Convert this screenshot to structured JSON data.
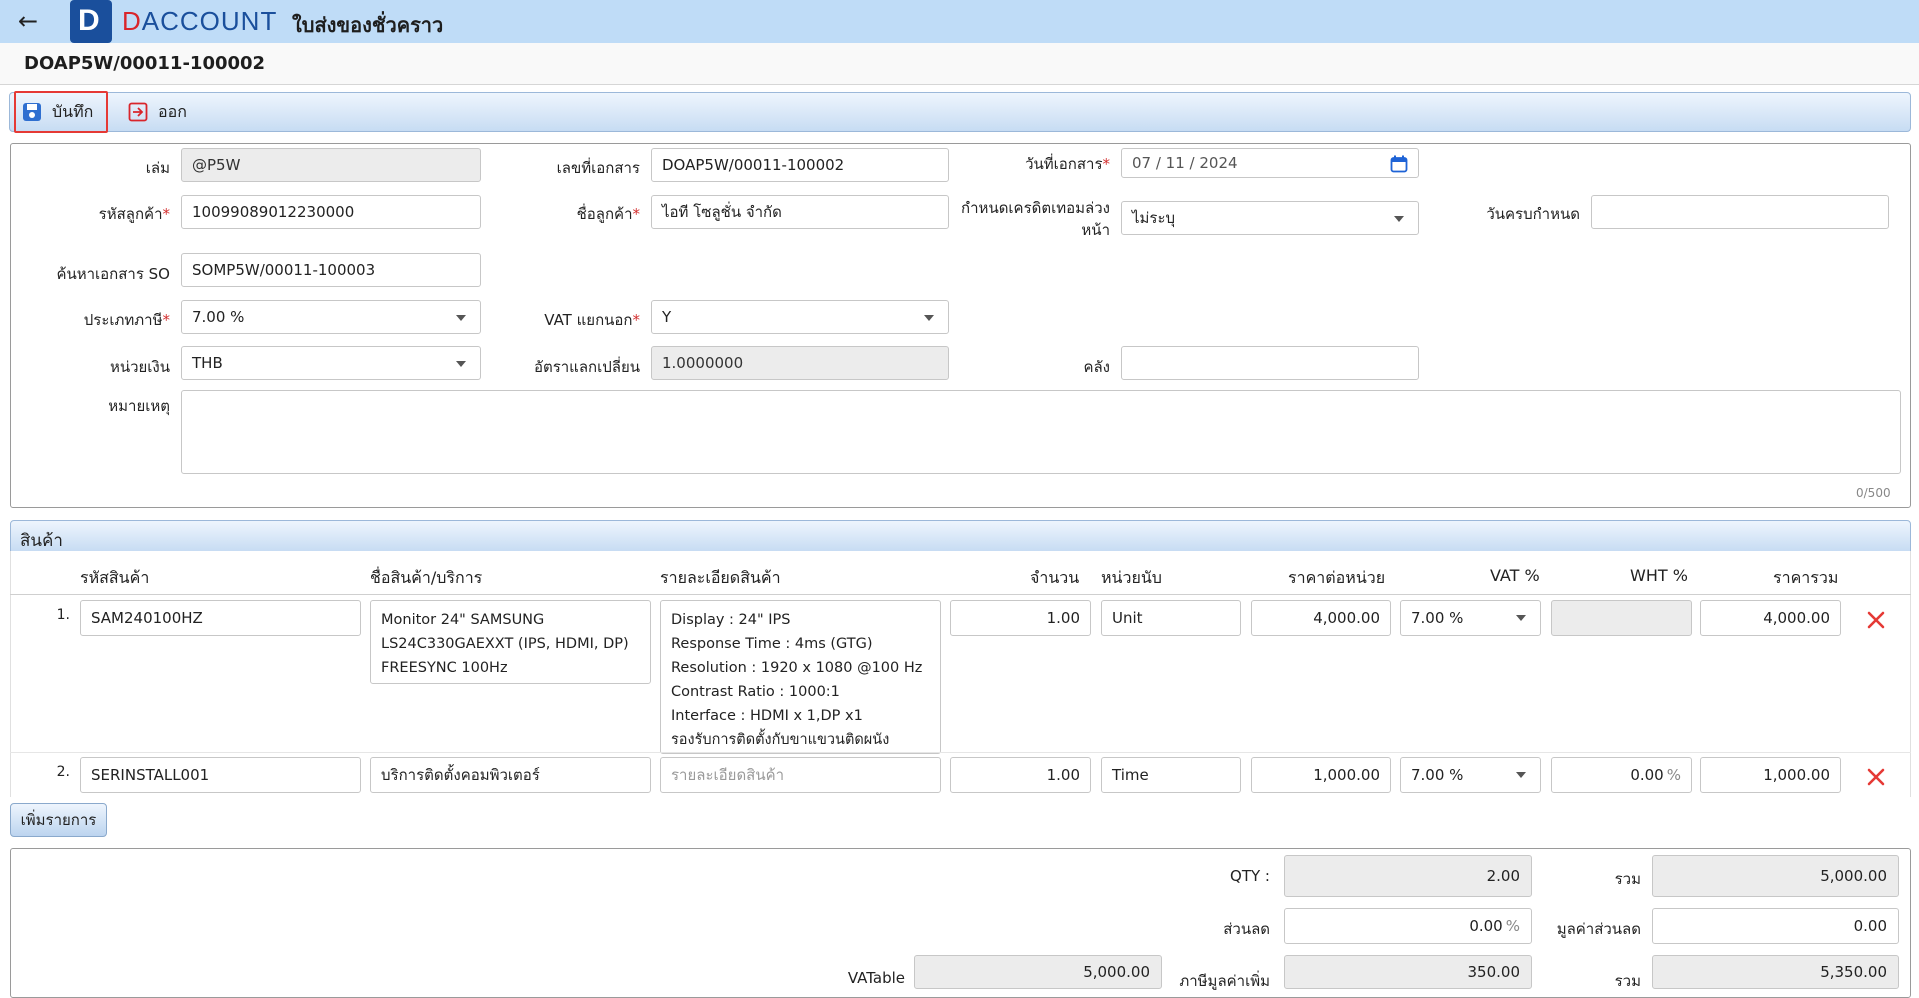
{
  "app": {
    "brand": "ACCOUNT",
    "title": "ใบส่งของชั่วคราว",
    "doc_heading": "DOAP5W/00011-100002"
  },
  "toolbar": {
    "save_label": "บันทึก",
    "exit_label": "ออก"
  },
  "form": {
    "book_label": "เล่ม",
    "book_value": "@P5W",
    "doc_no_label": "เลขที่เอกสาร",
    "doc_no_value": "DOAP5W/00011-100002",
    "doc_date_label": "วันที่เอกสาร",
    "doc_date_value": "07 / 11 /  2024",
    "customer_code_label": "รหัสลูกค้า",
    "customer_code_value": "10099089012230000",
    "customer_name_label": "ชื่อลูกค้า",
    "customer_name_value": "ไอที โซลูชั่น จำกัด",
    "credit_term_label_1": "กำหนดเครดิตเทอมล่วง",
    "credit_term_label_2": "หน้า",
    "credit_term_value": "ไม่ระบุ",
    "due_date_label": "วันครบกำหนด",
    "due_date_value": "",
    "so_search_label": "ค้นหาเอกสาร SO",
    "so_search_value": "SOMP5W/00011-100003",
    "tax_type_label": "ประเภทภาษี",
    "tax_type_value": "7.00 %",
    "vat_separate_label": "VAT แยกนอก",
    "vat_separate_value": "Y",
    "currency_label": "หน่วยเงิน",
    "currency_value": "THB",
    "exchange_rate_label": "อัตราแลกเปลี่ยน",
    "exchange_rate_value": "1.0000000",
    "warehouse_label": "คลัง",
    "warehouse_value": "",
    "remark_label": "หมายเหตุ",
    "remark_value": "",
    "remark_counter": "0/500"
  },
  "products": {
    "section_title": "สินค้า",
    "columns": {
      "code": "รหัสสินค้า",
      "name": "ชื่อสินค้า/บริการ",
      "detail": "รายละเอียดสินค้า",
      "qty": "จำนวน",
      "unit": "หน่วยนับ",
      "unit_price": "ราคาต่อหน่วย",
      "vat": "VAT %",
      "wht": "WHT %",
      "total": "ราคารวม"
    },
    "detail_placeholder": "รายละเอียดสินค้า",
    "rows": [
      {
        "no": "1.",
        "code": "SAM240100HZ",
        "name_lines": [
          "Monitor 24\" SAMSUNG",
          "LS24C330GAEXXT (IPS, HDMI, DP)",
          "FREESYNC 100Hz"
        ],
        "detail_lines": [
          "Display : 24\" IPS",
          "Response Time : 4ms (GTG)",
          "Resolution : 1920 x 1080 @100 Hz",
          "Contrast Ratio : 1000:1",
          "Interface : HDMI x 1,DP x1",
          "รองรับการติดตั้งกับขาแขวนติดผนัง"
        ],
        "qty": "1.00",
        "unit": "Unit",
        "unit_price": "4,000.00",
        "vat": "7.00 %",
        "wht": "",
        "total": "4,000.00"
      },
      {
        "no": "2.",
        "code": "SERINSTALL001",
        "name_lines": [
          "บริการติดตั้งคอมพิวเตอร์"
        ],
        "detail_lines": [],
        "qty": "1.00",
        "unit": "Time",
        "unit_price": "1,000.00",
        "vat": "7.00 %",
        "wht": "0.00",
        "wht_suffix": "%",
        "total": "1,000.00"
      }
    ],
    "add_row_label": "เพิ่มรายการ"
  },
  "summary": {
    "qty_label": "QTY :",
    "qty_value": "2.00",
    "sum_label": "รวม",
    "sum_value": "5,000.00",
    "discount_label": "ส่วนลด",
    "discount_value": "0.00",
    "discount_suffix": "%",
    "discount_amount_label": "มูลค่าส่วนลด",
    "discount_amount_value": "0.00",
    "vatable_label": "VATable",
    "vatable_value": "5,000.00",
    "vat_label": "ภาษีมูลค่าเพิ่ม",
    "vat_value": "350.00",
    "grand_label": "รวม",
    "grand_value": "5,350.00"
  },
  "colors": {
    "topbar": "#bfdcf7",
    "brand": "#1a4f9c",
    "accent_red": "#e53935",
    "delete_red": "#e53935"
  }
}
